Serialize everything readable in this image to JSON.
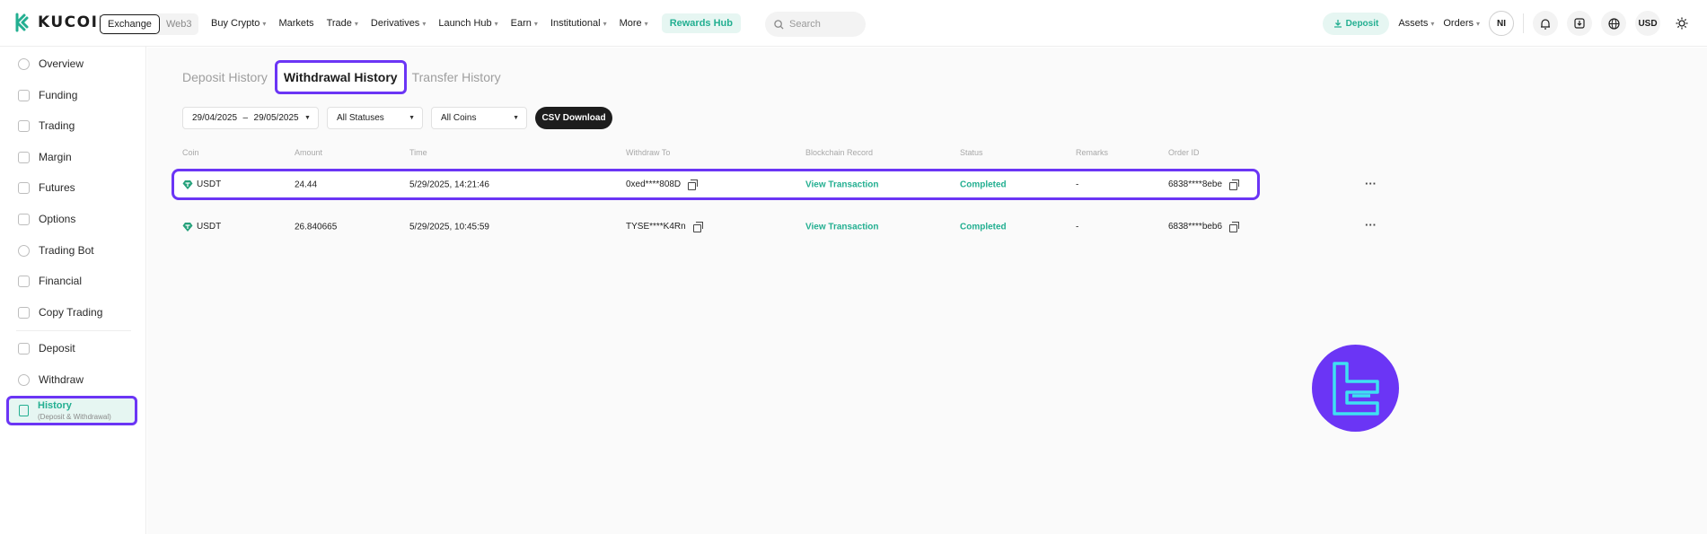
{
  "header": {
    "logo_text": "KUCOIN",
    "switch": {
      "active": "Exchange",
      "inactive": "Web3"
    },
    "nav": [
      {
        "label": "Buy Crypto",
        "caret": true
      },
      {
        "label": "Markets",
        "caret": false
      },
      {
        "label": "Trade",
        "caret": true
      },
      {
        "label": "Derivatives",
        "caret": true
      },
      {
        "label": "Launch Hub",
        "caret": true
      },
      {
        "label": "Earn",
        "caret": true
      },
      {
        "label": "Institutional",
        "caret": true
      },
      {
        "label": "More",
        "caret": true
      }
    ],
    "rewards_label": "Rewards Hub",
    "search_placeholder": "Search",
    "deposit_label": "Deposit",
    "assets_label": "Assets",
    "orders_label": "Orders",
    "avatar_initials": "NI",
    "currency": "USD"
  },
  "sidebar": {
    "items": [
      {
        "label": "Overview"
      },
      {
        "label": "Funding"
      },
      {
        "label": "Trading"
      },
      {
        "label": "Margin"
      },
      {
        "label": "Futures"
      },
      {
        "label": "Options"
      },
      {
        "label": "Trading Bot"
      },
      {
        "label": "Financial"
      },
      {
        "label": "Copy Trading"
      },
      {
        "label": "Deposit"
      },
      {
        "label": "Withdraw"
      }
    ],
    "active": {
      "label": "History",
      "sublabel": "(Deposit & Withdrawal)"
    }
  },
  "tabs": {
    "deposit": "Deposit History",
    "withdrawal": "Withdrawal History",
    "transfer": "Transfer History"
  },
  "filters": {
    "date_from": "29/04/2025",
    "date_sep": "–",
    "date_to": "29/05/2025",
    "status": "All Statuses",
    "coins": "All Coins",
    "csv_label": "CSV Download"
  },
  "table": {
    "headers": [
      "Coin",
      "Amount",
      "Time",
      "Withdraw To",
      "Blockchain Record",
      "Status",
      "Remarks",
      "Order ID"
    ],
    "rows": [
      {
        "coin": "USDT",
        "amount": "24.44",
        "time": "5/29/2025, 14:21:46",
        "withdraw_to": "0xed****808D",
        "record": "View Transaction",
        "status": "Completed",
        "remarks": "-",
        "order_id": "6838****8ebe",
        "more": "···"
      },
      {
        "coin": "USDT",
        "amount": "26.840665",
        "time": "5/29/2025, 10:45:59",
        "withdraw_to": "TYSE****K4Rn",
        "record": "View Transaction",
        "status": "Completed",
        "remarks": "-",
        "order_id": "6838****beb6",
        "more": "···"
      }
    ]
  },
  "colors": {
    "accent": "#23af91",
    "highlight": "#6b35f5",
    "watermark_glyph": "#3ee0f2"
  }
}
